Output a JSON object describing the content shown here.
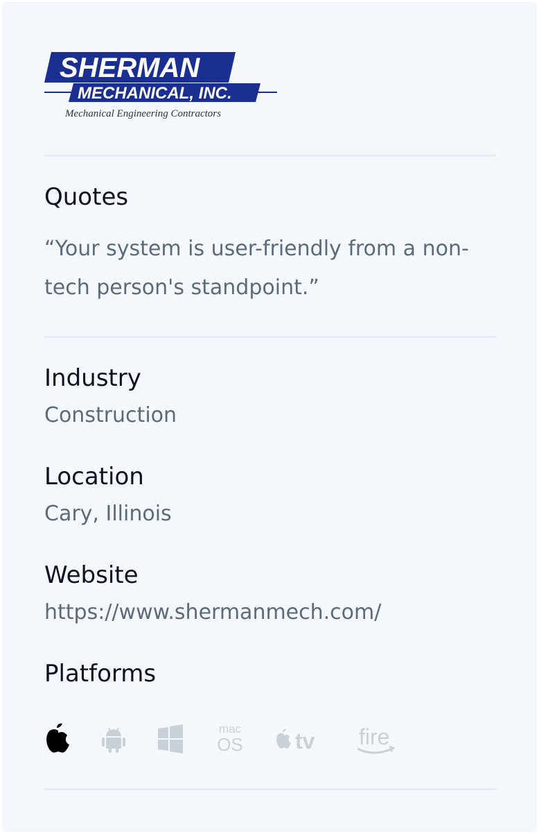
{
  "company": {
    "logo": {
      "name": "SHERMAN",
      "subname": "MECHANICAL, INC.",
      "tagline": "Mechanical Engineering Contractors"
    }
  },
  "quotes": {
    "title": "Quotes",
    "text": "“Your system is user-friendly from a non-tech person's standpoint.”"
  },
  "industry": {
    "title": "Industry",
    "value": "Construction"
  },
  "location": {
    "title": "Location",
    "value": "Cary, Illinois"
  },
  "website": {
    "title": "Website",
    "value": "https://www.shermanmech.com/"
  },
  "platforms": {
    "title": "Platforms",
    "items": [
      {
        "icon": "apple-icon",
        "active": true
      },
      {
        "icon": "android-icon",
        "active": false
      },
      {
        "icon": "windows-icon",
        "active": false
      },
      {
        "icon": "macos-icon",
        "active": false,
        "label_top": "mac",
        "label_bottom": "OS"
      },
      {
        "icon": "apple-tv-icon",
        "active": false,
        "label": "tv"
      },
      {
        "icon": "amazon-fire-icon",
        "active": false,
        "label": "fire"
      }
    ]
  },
  "colors": {
    "card_background": "#f4f8fc",
    "title_text": "#0b1320",
    "body_text": "#5c6b79",
    "divider": "#e3edf3",
    "icon_active": "#000000",
    "icon_inactive": "#c9d0d6",
    "logo_blue": "#1a2f8f"
  }
}
